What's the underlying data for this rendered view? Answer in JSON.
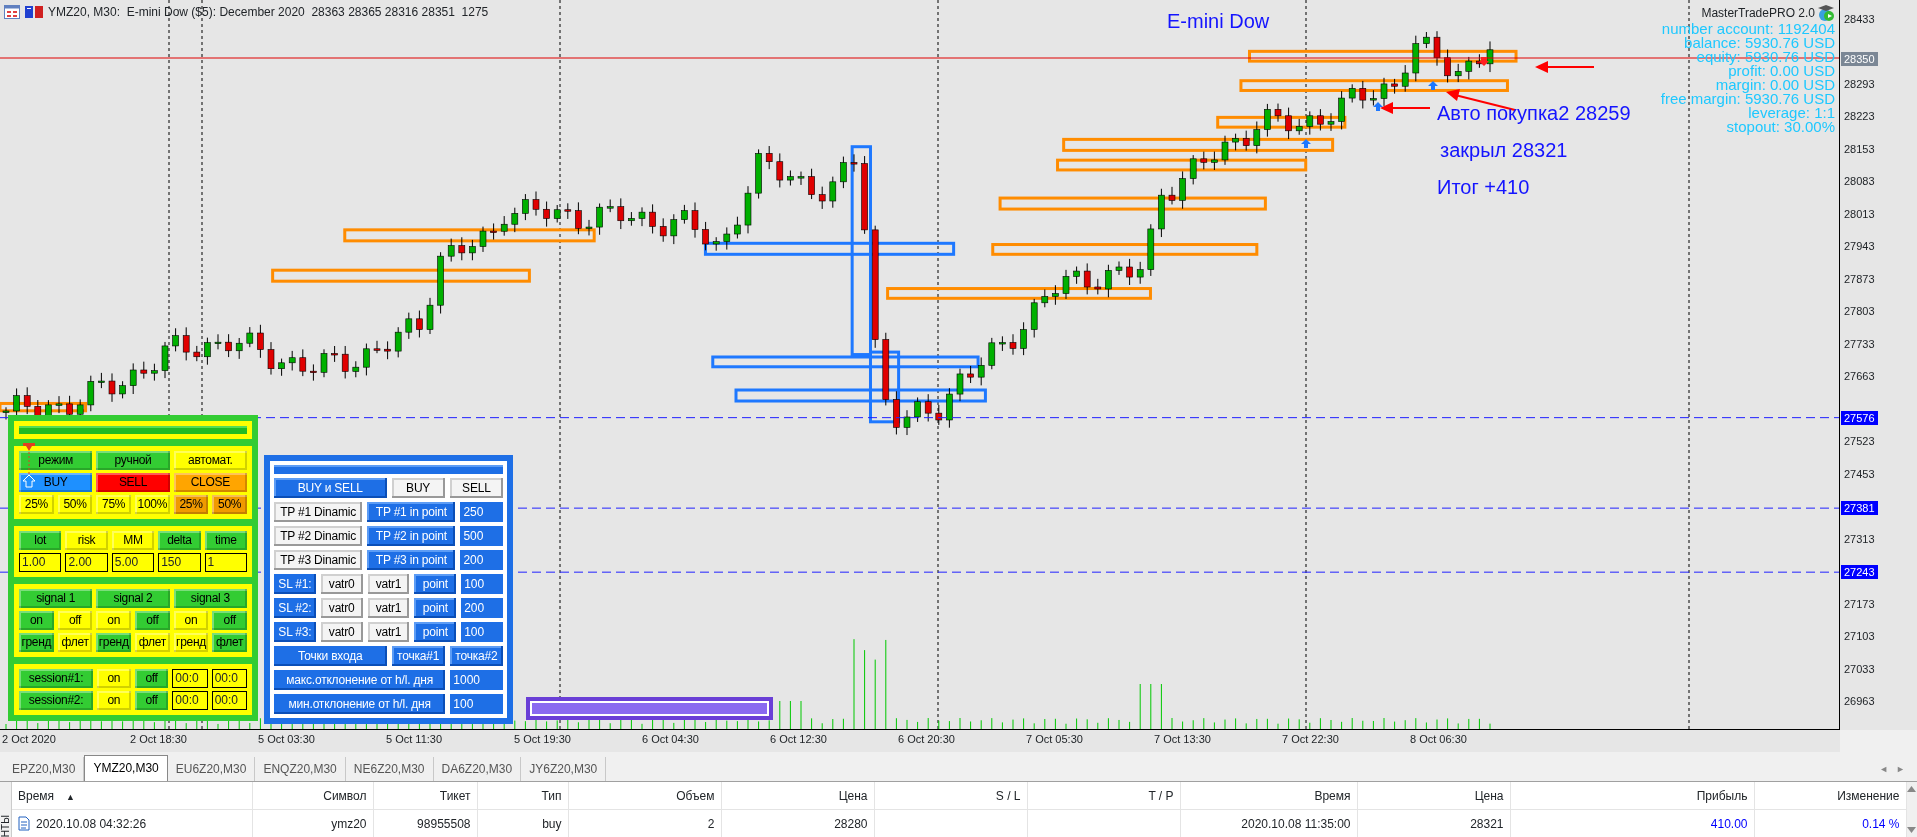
{
  "window": {
    "title": "YMZ20, M30:  E-mini Dow ($5): December 2020  28363 28365 28316 28351  1275"
  },
  "chart": {
    "annotations": [
      "E-mini Dow",
      "Авто покупка2 28259",
      "закрыл 28321",
      "Итог +410"
    ],
    "indicator": {
      "name": "MasterTradePRO 2.0",
      "lines": [
        "number account: 1192404",
        "balance: 5930.76 USD",
        "equity: 5930.76 USD",
        "profit: 0.00 USD",
        "margin: 0.00 USD",
        "free margin: 5930.76 USD",
        "leverage: 1:1",
        "stopout: 30.00%"
      ]
    },
    "price_labels": [
      "28433",
      "28293",
      "28223",
      "28153",
      "28083",
      "28013",
      "27943",
      "27873",
      "27803",
      "27733",
      "27663",
      "27523",
      "27453",
      "27313",
      "27173",
      "27103",
      "27033",
      "26963"
    ],
    "price_tags": [
      {
        "label": "28350",
        "color": "#7b8795"
      },
      {
        "label": "27576",
        "color": "#0000ff"
      },
      {
        "label": "27381",
        "color": "#0000ff"
      },
      {
        "label": "27243",
        "color": "#0000ff"
      }
    ],
    "time_labels": [
      "2 Oct 2020",
      "2 Oct 18:30",
      "5 Oct 03:30",
      "5 Oct 11:30",
      "5 Oct 19:30",
      "6 Oct 04:30",
      "6 Oct 12:30",
      "6 Oct 20:30",
      "7 Oct 05:30",
      "7 Oct 13:30",
      "7 Oct 22:30",
      "8 Oct 06:30"
    ]
  },
  "left_panel": {
    "sections": [
      {
        "rows": [
          [
            {
              "kind": "button",
              "label": "режим",
              "color": "#33cc33"
            },
            {
              "kind": "button",
              "label": "ручной",
              "color": "#33cc33"
            },
            {
              "kind": "button",
              "label": "автомат.",
              "color": "#ffff00"
            }
          ],
          [
            {
              "kind": "button",
              "label": "BUY",
              "color": "#1e90ff"
            },
            {
              "kind": "button",
              "label": "SELL",
              "color": "#ff0000"
            },
            {
              "kind": "button",
              "label": "CLOSE",
              "color": "#ffa500"
            }
          ],
          [
            {
              "kind": "button",
              "label": "25%",
              "color": "#ffff00"
            },
            {
              "kind": "button",
              "label": "50%",
              "color": "#ffff00"
            },
            {
              "kind": "button",
              "label": "75%",
              "color": "#ffff00"
            },
            {
              "kind": "button",
              "label": "100%",
              "color": "#ffff00"
            },
            {
              "kind": "button",
              "label": "25%",
              "color": "#f09a00"
            },
            {
              "kind": "button",
              "label": "50%",
              "color": "#f09a00"
            }
          ]
        ]
      },
      {
        "rows": [
          [
            {
              "kind": "button",
              "label": "lot",
              "color": "#33cc33"
            },
            {
              "kind": "button",
              "label": "risk",
              "color": "#ffff00"
            },
            {
              "kind": "button",
              "label": "MM",
              "color": "#ffff00"
            },
            {
              "kind": "button",
              "label": "delta",
              "color": "#33cc33"
            },
            {
              "kind": "button",
              "label": "time",
              "color": "#33cc33"
            }
          ],
          [
            {
              "kind": "field",
              "value": "1.00"
            },
            {
              "kind": "field",
              "value": "2.00"
            },
            {
              "kind": "field",
              "value": "5.00"
            },
            {
              "kind": "field",
              "value": "150"
            },
            {
              "kind": "field",
              "value": "1"
            }
          ]
        ]
      },
      {
        "rows": [
          [
            {
              "kind": "button",
              "label": "signal 1",
              "color": "#33cc33"
            },
            {
              "kind": "button",
              "label": "signal 2",
              "color": "#33cc33"
            },
            {
              "kind": "button",
              "label": "signal 3",
              "color": "#33cc33"
            }
          ],
          [
            {
              "kind": "button",
              "label": "on",
              "color": "#33cc33"
            },
            {
              "kind": "button",
              "label": "off",
              "color": "#ffff00"
            },
            {
              "kind": "button",
              "label": "on",
              "color": "#ffff00"
            },
            {
              "kind": "button",
              "label": "off",
              "color": "#33cc33"
            },
            {
              "kind": "button",
              "label": "on",
              "color": "#ffff00"
            },
            {
              "kind": "button",
              "label": "off",
              "color": "#33cc33"
            }
          ],
          [
            {
              "kind": "button",
              "label": "гренд",
              "color": "#33cc33"
            },
            {
              "kind": "button",
              "label": "флет",
              "color": "#ffff00"
            },
            {
              "kind": "button",
              "label": "гренд",
              "color": "#33cc33"
            },
            {
              "kind": "button",
              "label": "флет",
              "color": "#ffff00"
            },
            {
              "kind": "button",
              "label": "гренд",
              "color": "#ffff00"
            },
            {
              "kind": "button",
              "label": "флет",
              "color": "#33cc33"
            }
          ]
        ]
      },
      {
        "rows": [
          [
            {
              "kind": "button",
              "label": "session#1:",
              "color": "#33cc33"
            },
            {
              "kind": "button",
              "label": "on",
              "color": "#ffff00"
            },
            {
              "kind": "button",
              "label": "off",
              "color": "#33cc33"
            },
            {
              "kind": "field",
              "value": "00:0"
            },
            {
              "kind": "field",
              "value": "00:0"
            }
          ],
          [
            {
              "kind": "button",
              "label": "session#2:",
              "color": "#33cc33"
            },
            {
              "kind": "button",
              "label": "on",
              "color": "#ffff00"
            },
            {
              "kind": "button",
              "label": "off",
              "color": "#33cc33"
            },
            {
              "kind": "field",
              "value": "00:0"
            },
            {
              "kind": "field",
              "value": "00:0"
            }
          ]
        ]
      }
    ]
  },
  "trade_panel": {
    "rows": [
      {
        "kind": "trio",
        "items": [
          {
            "kind": "option",
            "label": "BUY и SELL",
            "selected": true
          },
          {
            "kind": "option",
            "label": "BUY",
            "selected": false
          },
          {
            "kind": "option",
            "label": "SELL",
            "selected": false
          }
        ]
      },
      {
        "kind": "tp",
        "items": [
          {
            "kind": "option",
            "label": "TP #1 Dinamic",
            "selected": false
          },
          {
            "kind": "option",
            "label": "TP #1 in point",
            "selected": true
          },
          {
            "kind": "field",
            "value": "250"
          }
        ]
      },
      {
        "kind": "tp",
        "items": [
          {
            "kind": "option",
            "label": "TP #2 Dinamic",
            "selected": false
          },
          {
            "kind": "option",
            "label": "TP #2 in point",
            "selected": true
          },
          {
            "kind": "field",
            "value": "500"
          }
        ]
      },
      {
        "kind": "tp",
        "items": [
          {
            "kind": "option",
            "label": "TP #3 Dinamic",
            "selected": false
          },
          {
            "kind": "option",
            "label": "TP #3 in point",
            "selected": true
          },
          {
            "kind": "field",
            "value": "200"
          }
        ]
      },
      {
        "kind": "sl",
        "items": [
          {
            "kind": "label",
            "label": "SL #1:"
          },
          {
            "kind": "option",
            "label": "vatr0",
            "selected": false
          },
          {
            "kind": "option",
            "label": "vatr1",
            "selected": false
          },
          {
            "kind": "option",
            "label": "point",
            "selected": true
          },
          {
            "kind": "field",
            "value": "100"
          }
        ]
      },
      {
        "kind": "sl",
        "items": [
          {
            "kind": "label",
            "label": "SL #2:"
          },
          {
            "kind": "option",
            "label": "vatr0",
            "selected": false
          },
          {
            "kind": "option",
            "label": "vatr1",
            "selected": false
          },
          {
            "kind": "option",
            "label": "point",
            "selected": true
          },
          {
            "kind": "field",
            "value": "200"
          }
        ]
      },
      {
        "kind": "sl",
        "items": [
          {
            "kind": "label",
            "label": "SL #3:"
          },
          {
            "kind": "option",
            "label": "vatr0",
            "selected": false
          },
          {
            "kind": "option",
            "label": "vatr1",
            "selected": false
          },
          {
            "kind": "option",
            "label": "point",
            "selected": true
          },
          {
            "kind": "field",
            "value": "100"
          }
        ]
      },
      {
        "kind": "trio",
        "items": [
          {
            "kind": "label",
            "label": "Точки входа"
          },
          {
            "kind": "option",
            "label": "точка#1",
            "selected": true
          },
          {
            "kind": "option",
            "label": "точка#2",
            "selected": true
          }
        ]
      },
      {
        "kind": "dev",
        "items": [
          {
            "kind": "label",
            "label": "макс.отклонение от h/l. дня"
          },
          {
            "kind": "field",
            "value": "1000"
          }
        ]
      },
      {
        "kind": "dev",
        "items": [
          {
            "kind": "label",
            "label": "мин.отклонение от h/l. дня"
          },
          {
            "kind": "field",
            "value": "100"
          }
        ]
      }
    ]
  },
  "terminal": {
    "tabs": [
      {
        "label": "EPZ20,M30",
        "selected": false
      },
      {
        "label": "YMZ20,M30",
        "selected": true
      },
      {
        "label": "EU6Z20,M30",
        "selected": false
      },
      {
        "label": "ENQZ20,M30",
        "selected": false
      },
      {
        "label": "NE6Z20,M30",
        "selected": false
      },
      {
        "label": "DA6Z20,M30",
        "selected": false
      },
      {
        "label": "JY6Z20,M30",
        "selected": false
      }
    ],
    "tab_scroll": [
      "◄",
      "►"
    ],
    "side_label": "НТЫ",
    "columns": [
      {
        "label": "Время",
        "sort_mark": "▲"
      },
      {
        "label": "Символ"
      },
      {
        "label": "Тикет"
      },
      {
        "label": "Тип"
      },
      {
        "label": "Объем"
      },
      {
        "label": "Цена"
      },
      {
        "label": "S / L"
      },
      {
        "label": "T / P"
      },
      {
        "label": "Время"
      },
      {
        "label": "Цена"
      },
      {
        "label": "Прибыль"
      },
      {
        "label": "Изменение"
      }
    ],
    "rows": [
      {
        "cells": [
          "2020.10.08 04:32:26",
          "ymz20",
          "98955508",
          "buy",
          "2",
          "28280",
          null,
          null,
          "2020.10.08 11:35:00",
          "28321"
        ],
        "profit": "410.00",
        "change": "0.14 %",
        "color": "#0000ff"
      }
    ]
  }
}
